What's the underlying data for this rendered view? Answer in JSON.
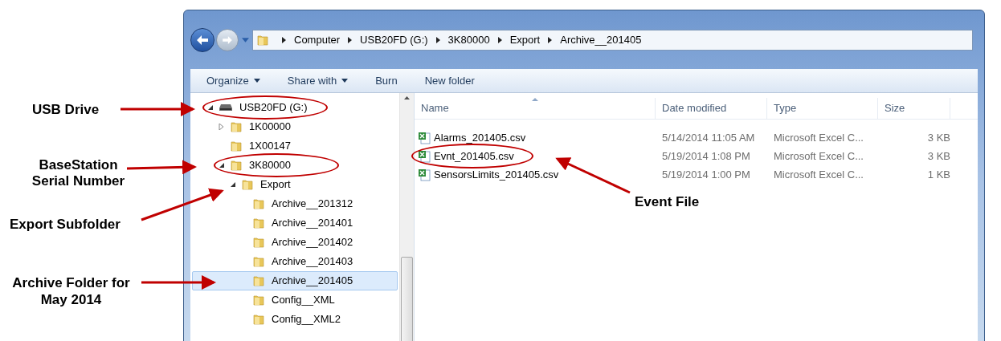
{
  "address_bar": {
    "segments": [
      "Computer",
      "USB20FD (G:)",
      "3K80000",
      "Export",
      "Archive__201405"
    ]
  },
  "toolbar": [
    {
      "label": "Organize",
      "dropdown": true
    },
    {
      "label": "Share with",
      "dropdown": true
    },
    {
      "label": "Burn",
      "dropdown": false
    },
    {
      "label": "New folder",
      "dropdown": false
    }
  ],
  "nav_tree": [
    {
      "label": "USB20FD (G:)",
      "kind": "drive",
      "expanded": true,
      "selected": false,
      "circled": true,
      "children": [
        {
          "label": "1K00000",
          "kind": "folder",
          "expanded": false,
          "selected": false,
          "circled": false
        },
        {
          "label": "1X00147",
          "kind": "folder",
          "selected": false,
          "circled": false
        },
        {
          "label": "3K80000",
          "kind": "folder",
          "expanded": true,
          "selected": false,
          "circled": true,
          "children": [
            {
              "label": "Export",
              "kind": "folder",
              "expanded": true,
              "selected": false,
              "circled": false,
              "children": [
                {
                  "label": "Archive__201312",
                  "kind": "folder",
                  "selected": false,
                  "circled": false
                },
                {
                  "label": "Archive__201401",
                  "kind": "folder",
                  "selected": false,
                  "circled": false
                },
                {
                  "label": "Archive__201402",
                  "kind": "folder",
                  "selected": false,
                  "circled": false
                },
                {
                  "label": "Archive__201403",
                  "kind": "folder",
                  "selected": false,
                  "circled": false
                },
                {
                  "label": "Archive__201405",
                  "kind": "folder",
                  "selected": true,
                  "circled": false
                },
                {
                  "label": "Config__XML",
                  "kind": "folder",
                  "selected": false,
                  "circled": false
                },
                {
                  "label": "Config__XML2",
                  "kind": "folder",
                  "selected": false,
                  "circled": false
                }
              ]
            }
          ]
        }
      ]
    }
  ],
  "file_list": {
    "columns": [
      "Name",
      "Date modified",
      "Type",
      "Size"
    ],
    "rows": [
      {
        "name": "Alarms_201405.csv",
        "date": "5/14/2014 11:05 AM",
        "type": "Microsoft Excel C...",
        "size": "3 KB",
        "circled": false
      },
      {
        "name": "Evnt_201405.csv",
        "date": "5/19/2014 1:08 PM",
        "type": "Microsoft Excel C...",
        "size": "3 KB",
        "circled": true
      },
      {
        "name": "SensorsLimits_201405.csv",
        "date": "5/19/2014 1:00 PM",
        "type": "Microsoft Excel C...",
        "size": "1 KB",
        "circled": false
      }
    ]
  },
  "annotations": [
    {
      "text": "USB Drive"
    },
    {
      "text": "BaseStation Serial Number"
    },
    {
      "text": "Export Subfolder"
    },
    {
      "text": "Archive Folder for May 2014"
    },
    {
      "text": "Event File"
    }
  ]
}
